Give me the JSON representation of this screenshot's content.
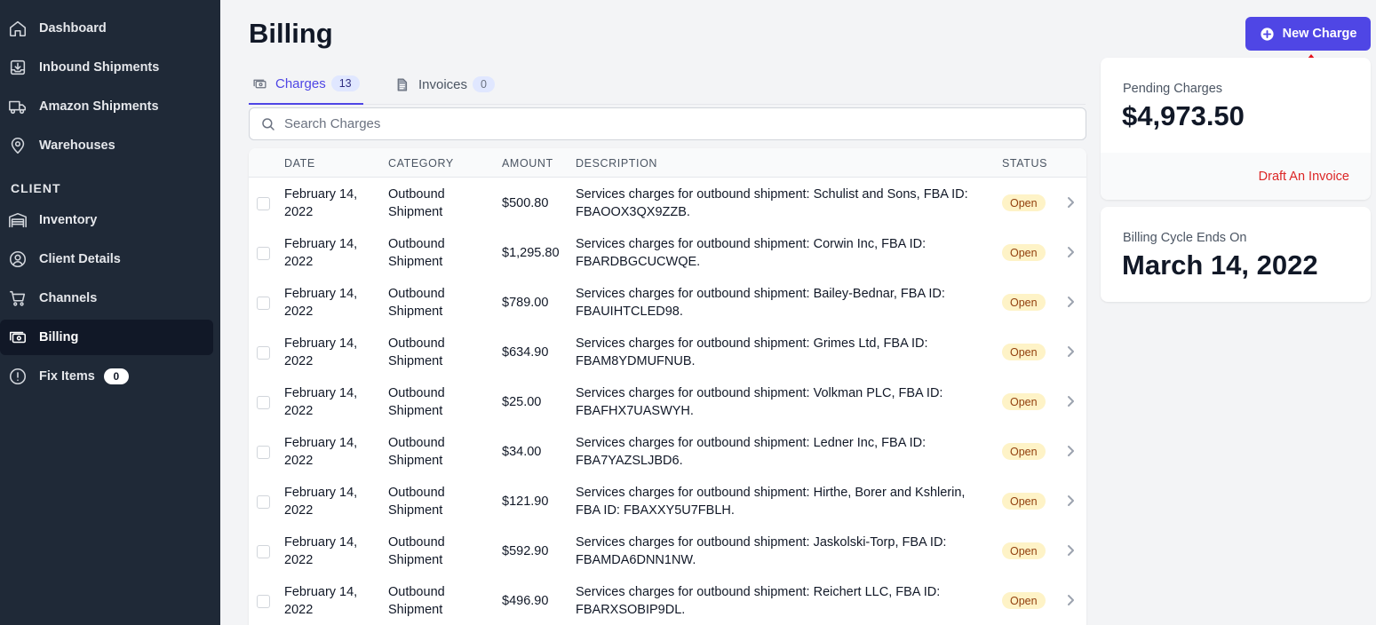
{
  "sidebar": {
    "items": [
      {
        "label": "Dashboard",
        "icon": "home-icon"
      },
      {
        "label": "Inbound Shipments",
        "icon": "inbox-download-icon"
      },
      {
        "label": "Amazon Shipments",
        "icon": "truck-icon"
      },
      {
        "label": "Warehouses",
        "icon": "map-pin-icon"
      }
    ],
    "section_label": "CLIENT",
    "client_items": [
      {
        "label": "Inventory",
        "icon": "warehouse-shelves-icon"
      },
      {
        "label": "Client Details",
        "icon": "user-circle-icon"
      },
      {
        "label": "Channels",
        "icon": "shopping-cart-icon"
      },
      {
        "label": "Billing",
        "icon": "cash-icon",
        "active": true
      },
      {
        "label": "Fix Items",
        "icon": "exclamation-circle-icon",
        "badge": "0"
      }
    ]
  },
  "page": {
    "title": "Billing"
  },
  "tabs": [
    {
      "label": "Charges",
      "count": "13",
      "icon": "cash-icon"
    },
    {
      "label": "Invoices",
      "count": "0",
      "icon": "document-icon"
    }
  ],
  "search": {
    "placeholder": "Search Charges",
    "value": ""
  },
  "table": {
    "headers": [
      "DATE",
      "CATEGORY",
      "AMOUNT",
      "DESCRIPTION",
      "STATUS"
    ],
    "rows": [
      {
        "date_line1": "February 14,",
        "date_line2": "2022",
        "cat_line1": "Outbound",
        "cat_line2": "Shipment",
        "amount": "$500.80",
        "desc_line1": "Services charges for outbound shipment: Schulist and Sons, FBA ID:",
        "desc_line2": "FBAOOX3QX9ZZB.",
        "status": "Open"
      },
      {
        "date_line1": "February 14,",
        "date_line2": "2022",
        "cat_line1": "Outbound",
        "cat_line2": "Shipment",
        "amount": "$1,295.80",
        "desc_line1": "Services charges for outbound shipment: Corwin Inc, FBA ID:",
        "desc_line2": "FBARDBGCUCWQE.",
        "status": "Open"
      },
      {
        "date_line1": "February 14,",
        "date_line2": "2022",
        "cat_line1": "Outbound",
        "cat_line2": "Shipment",
        "amount": "$789.00",
        "desc_line1": "Services charges for outbound shipment: Bailey-Bednar, FBA ID:",
        "desc_line2": "FBAUIHTCLED98.",
        "status": "Open"
      },
      {
        "date_line1": "February 14,",
        "date_line2": "2022",
        "cat_line1": "Outbound",
        "cat_line2": "Shipment",
        "amount": "$634.90",
        "desc_line1": "Services charges for outbound shipment: Grimes Ltd, FBA ID:",
        "desc_line2": "FBAM8YDMUFNUB.",
        "status": "Open"
      },
      {
        "date_line1": "February 14,",
        "date_line2": "2022",
        "cat_line1": "Outbound",
        "cat_line2": "Shipment",
        "amount": "$25.00",
        "desc_line1": "Services charges for outbound shipment: Volkman PLC, FBA ID:",
        "desc_line2": "FBAFHX7UASWYH.",
        "status": "Open"
      },
      {
        "date_line1": "February 14,",
        "date_line2": "2022",
        "cat_line1": "Outbound",
        "cat_line2": "Shipment",
        "amount": "$34.00",
        "desc_line1": "Services charges for outbound shipment: Ledner Inc, FBA ID:",
        "desc_line2": "FBA7YAZSLJBD6.",
        "status": "Open"
      },
      {
        "date_line1": "February 14,",
        "date_line2": "2022",
        "cat_line1": "Outbound",
        "cat_line2": "Shipment",
        "amount": "$121.90",
        "desc_line1": "Services charges for outbound shipment: Hirthe, Borer and Kshlerin,",
        "desc_line2": "FBA ID: FBAXXY5U7FBLH.",
        "status": "Open"
      },
      {
        "date_line1": "February 14,",
        "date_line2": "2022",
        "cat_line1": "Outbound",
        "cat_line2": "Shipment",
        "amount": "$592.90",
        "desc_line1": "Services charges for outbound shipment: Jaskolski-Torp, FBA ID:",
        "desc_line2": "FBAMDA6DNN1NW.",
        "status": "Open"
      },
      {
        "date_line1": "February 14,",
        "date_line2": "2022",
        "cat_line1": "Outbound",
        "cat_line2": "Shipment",
        "amount": "$496.90",
        "desc_line1": "Services charges for outbound shipment: Reichert LLC, FBA ID:",
        "desc_line2": "FBARXSOBIP9DL.",
        "status": "Open"
      }
    ]
  },
  "actions": {
    "new_charge_label": "New Charge",
    "new_charge_icon": "plus-circle-icon"
  },
  "pending_card": {
    "label": "Pending Charges",
    "value": "$4,973.50",
    "link": "Draft An Invoice"
  },
  "cycle_card": {
    "label": "Billing Cycle Ends On",
    "value": "March 14, 2022"
  },
  "colors": {
    "sidebar_bg": "#1f2937",
    "accent": "#4f46e5",
    "status_open_bg": "#fef3c7",
    "status_open_text": "#92400e",
    "danger": "#dc2626",
    "annotation_arrow": "#e5101a"
  }
}
